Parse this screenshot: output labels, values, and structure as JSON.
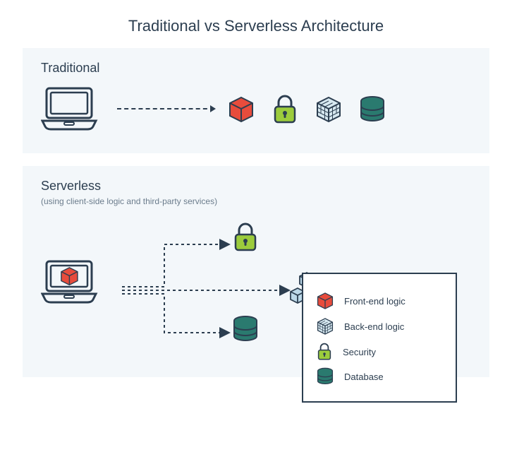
{
  "title": "Traditional vs Serverless Architecture",
  "traditional": {
    "heading": "Traditional"
  },
  "serverless": {
    "heading": "Serverless",
    "subheading": "(using client-side logic and third-party services)"
  },
  "legend": {
    "front": "Front-end logic",
    "back": "Back-end logic",
    "security": "Security",
    "database": "Database"
  },
  "colors": {
    "outline": "#2c3e50",
    "red": "#e74c3c",
    "green": "#8bc34a",
    "blue": "#bcd8e8",
    "teal": "#2a7a6f"
  }
}
